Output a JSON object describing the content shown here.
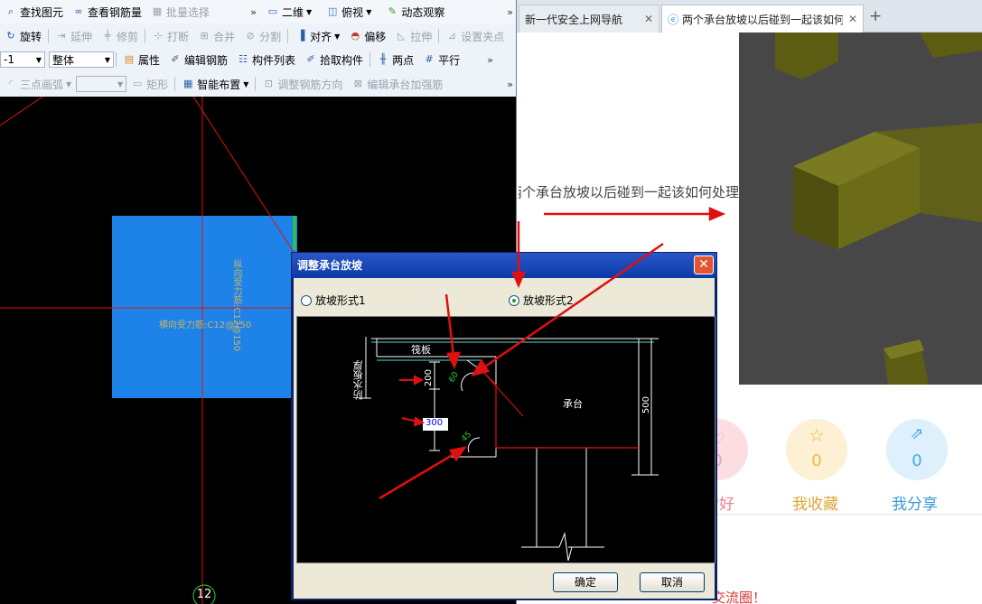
{
  "cad": {
    "toolbar1": {
      "find_element": "查找图元",
      "view_rebar_qty": "查看钢筋量",
      "batch_select": "批量选择",
      "view_2d": "二维",
      "top_view": "俯视",
      "dynamic_view": "动态观察"
    },
    "toolbar2": {
      "rotate": "旋转",
      "extend": "延伸",
      "trim": "修剪",
      "break": "打断",
      "merge": "合并",
      "split": "分割",
      "align": "对齐",
      "offset": "偏移",
      "stretch": "拉伸",
      "set_grip": "设置夹点"
    },
    "toolbar3": {
      "layer_value": "-1",
      "scope_value": "整体",
      "properties": "属性",
      "edit_rebar": "编辑钢筋",
      "component_list": "构件列表",
      "pick_component": "拾取构件",
      "two_points": "两点",
      "parallel": "平行"
    },
    "toolbar4": {
      "three_point_arc": "三点画弧",
      "rectangle": "矩形",
      "smart_layout": "智能布置",
      "adjust_rebar_dir": "调整钢筋方向",
      "edit_cap_rebar": "编辑承台加强筋"
    },
    "canvas": {
      "horizontal_rebar": "横向受力筋:C12@150",
      "vertical_rebar": "纵向受力筋:C12@150",
      "axis_number": "12"
    }
  },
  "browser": {
    "tabs": [
      {
        "label": "新一代安全上网导航",
        "active": false
      },
      {
        "label": "两个承台放坡以后碰到一起该如何处理",
        "active": true
      }
    ],
    "new_tab": "+",
    "question_title": "两个承台放坡以后碰到一起该如何处理",
    "stats": [
      {
        "label": "点赞好",
        "count": "0",
        "color": "#f2a3ae"
      },
      {
        "label": "我收藏",
        "count": "0",
        "color": "#f0c567"
      },
      {
        "label": "我分享",
        "count": "0",
        "color": "#5fb4e6"
      }
    ],
    "footer_text": "交流圈！"
  },
  "dialog": {
    "title": "调整承台放坡",
    "close": "✕",
    "option1": "放坡形式1",
    "option2": "放坡形式2",
    "selected_option": 2,
    "diagram": {
      "raft": "筏板",
      "waterproof": "防水板厚",
      "pile_cap": "承台",
      "dim_200": "200",
      "dim_300": "300",
      "dim_500": "500",
      "angle_60": "60",
      "angle_45": "45"
    },
    "ok": "确定",
    "cancel": "取消"
  },
  "colors": {
    "accent_blue": "#1e83e8",
    "annotation_red": "#e01010",
    "dialog_titlebar": "#0b3ba8",
    "render_olive": "#5a5a10"
  }
}
